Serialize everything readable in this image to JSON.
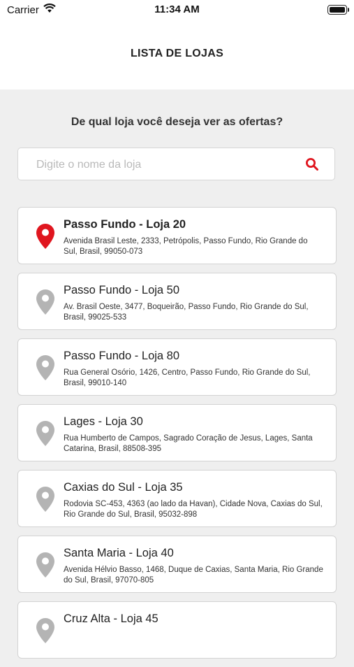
{
  "status_bar": {
    "carrier": "Carrier",
    "time": "11:34 AM"
  },
  "header": {
    "title": "LISTA DE LOJAS"
  },
  "main": {
    "question": "De qual loja você deseja ver as ofertas?",
    "search": {
      "placeholder": "Digite o nome da loja",
      "value": ""
    }
  },
  "colors": {
    "accent": "#e0161f",
    "pin_inactive": "#b4b4b4",
    "background": "#efefef"
  },
  "stores": [
    {
      "name": "Passo Fundo -  Loja 20",
      "address": "Avenida Brasil Leste, 2333, Petrópolis, Passo Fundo, Rio Grande do Sul, Brasil, 99050-073",
      "selected": true
    },
    {
      "name": "Passo Fundo -  Loja 50",
      "address": "Av. Brasil Oeste, 3477, Boqueirão, Passo Fundo, Rio Grande do Sul, Brasil, 99025-533",
      "selected": false
    },
    {
      "name": "Passo Fundo -  Loja 80",
      "address": "Rua General Osório, 1426, Centro, Passo Fundo, Rio Grande do Sul, Brasil, 99010-140",
      "selected": false
    },
    {
      "name": "Lages -  Loja 30",
      "address": "Rua Humberto de Campos, Sagrado Coração de Jesus, Lages, Santa Catarina, Brasil, 88508-395",
      "selected": false
    },
    {
      "name": "Caxias do Sul -  Loja 35",
      "address": "Rodovia SC-453, 4363 (ao lado da Havan), Cidade Nova, Caxias do Sul, Rio Grande do Sul, Brasil, 95032-898",
      "selected": false
    },
    {
      "name": "Santa Maria -  Loja 40",
      "address": "Avenida Hélvio Basso, 1468, Duque de Caxias, Santa Maria, Rio Grande do Sul, Brasil, 97070-805",
      "selected": false
    },
    {
      "name": "Cruz Alta -  Loja 45",
      "address": "",
      "selected": false
    }
  ]
}
